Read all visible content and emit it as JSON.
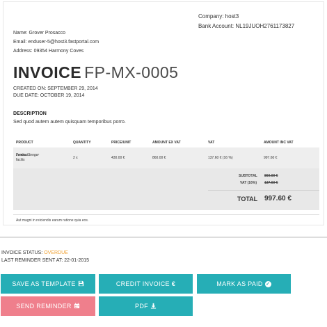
{
  "company": {
    "name_line": "Company: host3",
    "bank_line": "Bank Account: NL19JUOH2761173827"
  },
  "client": {
    "name_line": "Name: Grover Prosacco",
    "email_line": "Email: enduser-5@host3.fastportal.com",
    "address_line": "Address: 09354 Harmony Coves"
  },
  "invoice": {
    "title_word": "INVOICE",
    "number": "FP-MX-0005",
    "created_on": "CREATED ON: SEPTEMBER 29, 2014",
    "due_date": "DUE DATE: OCTOBER 19, 2014",
    "description_heading": "DESCRIPTION",
    "description_text": "Sed quod autem autem quisquam temporibus porro."
  },
  "table": {
    "headers": [
      "PRODUCT",
      "QUANTITY",
      "PRICE/UNIT",
      "AMOUNT EX VAT",
      "VAT",
      "AMOUNT INC VAT"
    ],
    "rows": [
      {
        "product": "Product - facilis",
        "vendor": "Lenora Senger",
        "quantity": "2 x",
        "price_unit": "430.00 €",
        "amount_ex_vat": "860.00 €",
        "vat": "137.60 € (16 %)",
        "amount_inc_vat": "997.60 €"
      }
    ]
  },
  "totals": {
    "subtotal_label": "SUBTOTAL",
    "subtotal_value": "860.00 €",
    "vat_label": "VAT (16%)",
    "vat_value": "137.60 €",
    "total_label": "TOTAL",
    "total_value": "997.60 €"
  },
  "footnote": "Aut magni in reiciendis earum ratione quia eos.",
  "status": {
    "label": "INVOICE STATUS:",
    "value": "OVERDUE",
    "value_color": "#f0a030",
    "reminder_line": "LAST REMINDER SENT AT: 22-01-2015"
  },
  "actions": {
    "save_template": "SAVE AS TEMPLATE",
    "credit_invoice": "CREDIT INVOICE",
    "mark_as_paid": "MARK AS PAID",
    "send_reminder": "SEND REMINDER",
    "pdf": "PDF"
  },
  "icons": {
    "save": "floppy-disk-icon",
    "credit": "euro-icon",
    "paid": "check-circle-icon",
    "reminder": "calendar-icon",
    "pdf": "download-icon"
  },
  "colors": {
    "teal_button": "#26aeb6",
    "pink_button": "#ef7f8c",
    "overdue": "#f0a030"
  }
}
